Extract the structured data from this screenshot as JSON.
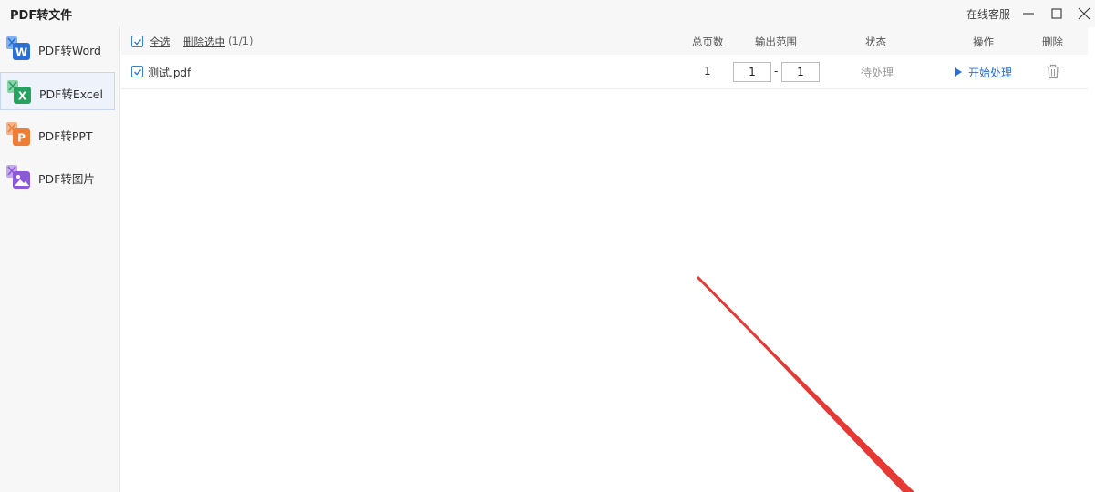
{
  "window": {
    "title": "PDF转文件",
    "online_service": "在线客服"
  },
  "sidebar": {
    "items": [
      {
        "label": "PDF转Word",
        "icon": "word-icon",
        "color": "#2b6fd6",
        "letter": "W"
      },
      {
        "label": "PDF转Excel",
        "icon": "excel-icon",
        "color": "#27a260",
        "letter": "X",
        "active": true
      },
      {
        "label": "PDF转PPT",
        "icon": "ppt-icon",
        "color": "#ef7d35",
        "letter": "P"
      },
      {
        "label": "PDF转图片",
        "icon": "image-icon",
        "color": "#8b5ad6",
        "letter": ""
      }
    ]
  },
  "toolbar": {
    "select_all": "全选",
    "delete_selected": "删除选中",
    "selected_count": "(1/1)"
  },
  "columns": {
    "total_pages": "总页数",
    "output_range": "输出范围",
    "status": "状态",
    "action": "操作",
    "delete": "删除"
  },
  "files": [
    {
      "name": "测试.pdf",
      "total_pages": "1",
      "range_start": "1",
      "range_sep": "-",
      "range_end": "1",
      "status": "待处理",
      "action": "开始处理"
    }
  ],
  "colors": {
    "accent": "#2b6fd6",
    "annotation": "#e53935"
  }
}
